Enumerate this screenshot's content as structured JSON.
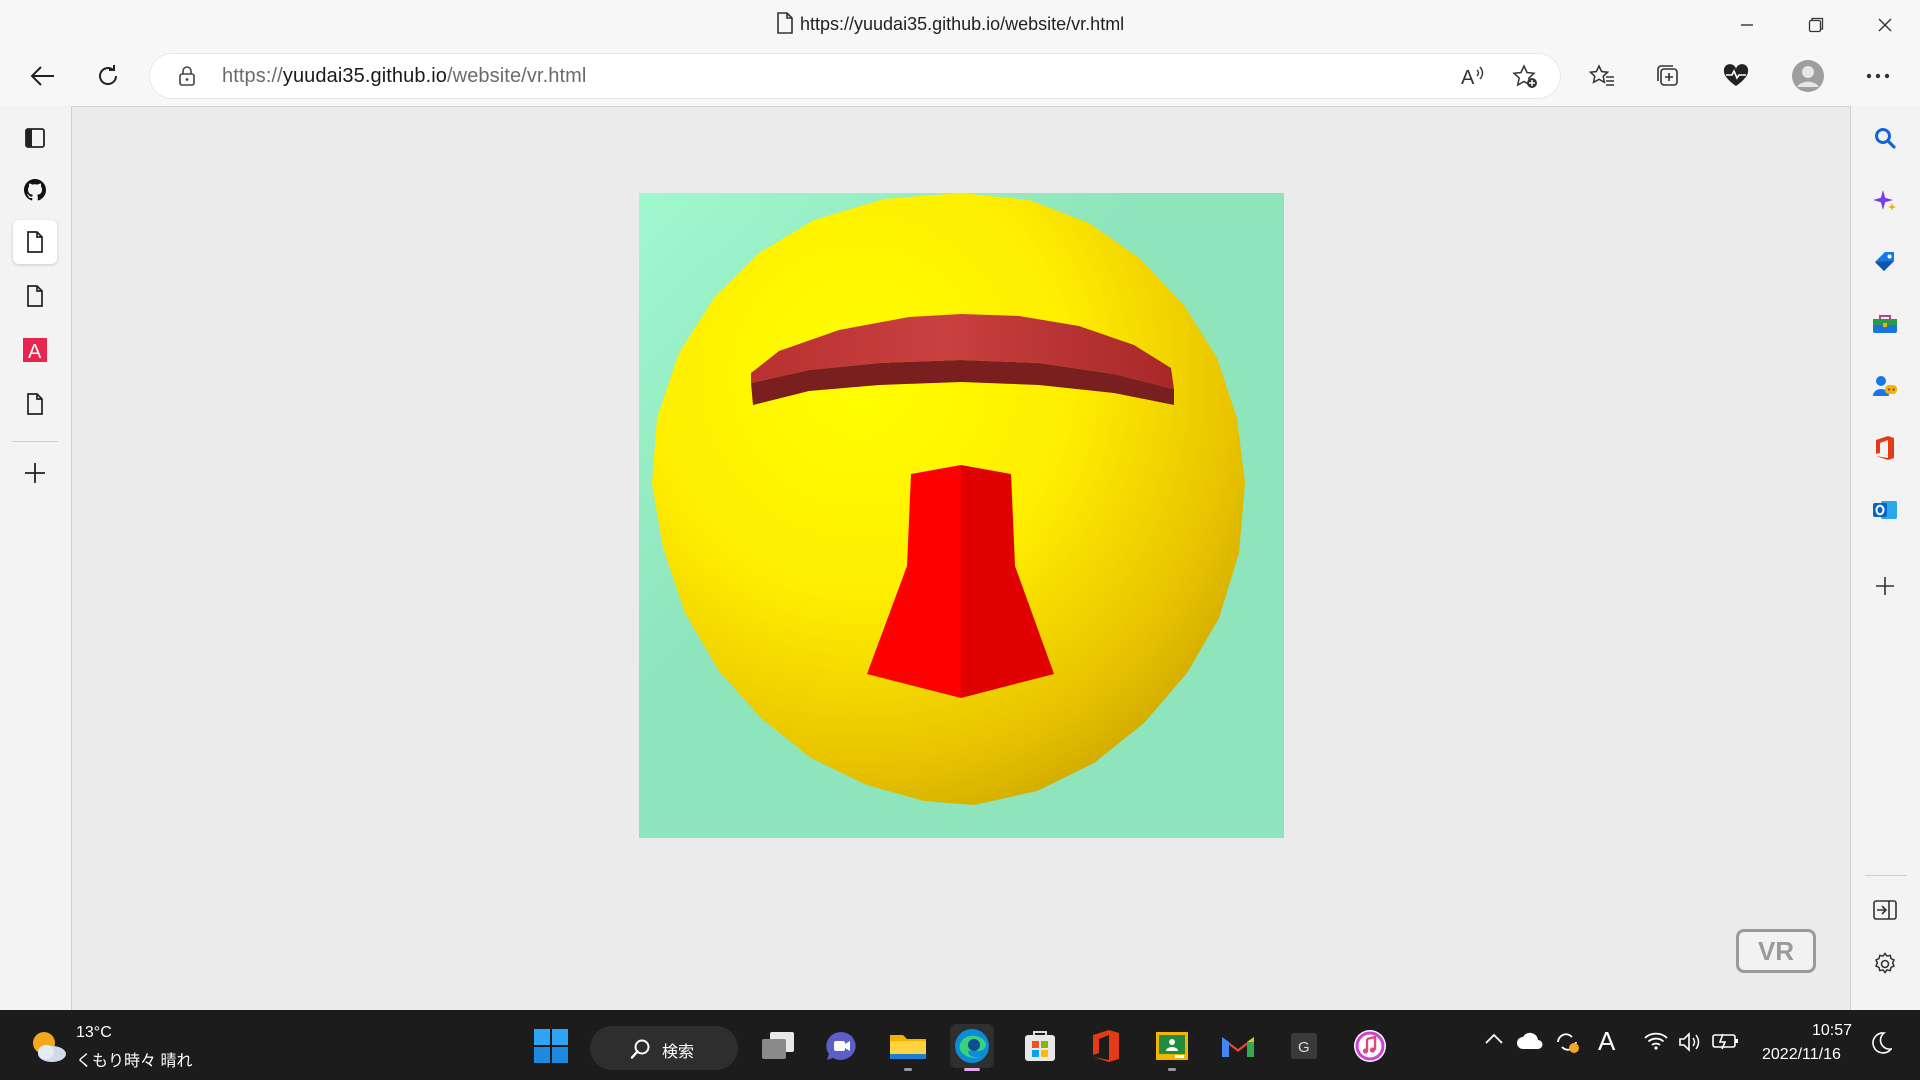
{
  "window": {
    "title": "https://yuudai35.github.io/website/vr.html",
    "minimize_icon": "minimize-icon",
    "restore_icon": "restore-icon",
    "close_icon": "close-icon"
  },
  "toolbar": {
    "url_prefix": "https://",
    "url_domain": "yuudai35.github.io",
    "url_path": "/website/vr.html"
  },
  "left_sidebar": {
    "items": [
      "tab-actions",
      "github",
      "page-active",
      "page",
      "a-icon-app",
      "page"
    ]
  },
  "page": {
    "vr_button": "VR",
    "background_color": "#8ee4bb",
    "face_color": "#ffff00",
    "brow_color": "#b93030",
    "nose_color": "#ff0000"
  },
  "taskbar": {
    "weather_temp": "13°C",
    "weather_desc": "くもり時々 晴れ",
    "search_label": "検索",
    "time": "10:57",
    "date": "2022/11/16",
    "ime": "A"
  }
}
